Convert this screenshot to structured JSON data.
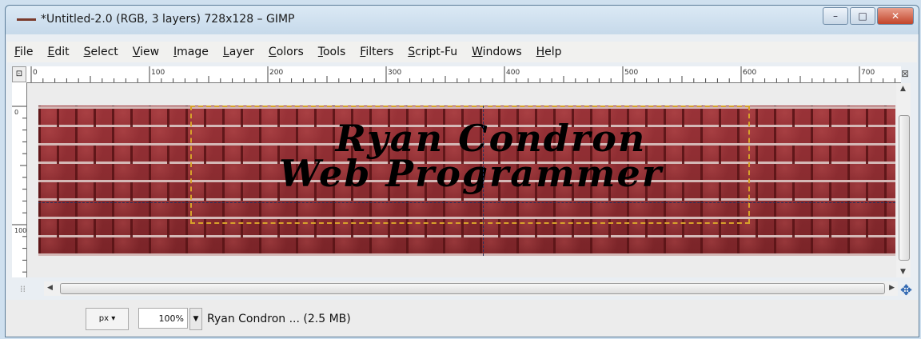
{
  "window": {
    "title": "*Untitled-2.0 (RGB, 3 layers) 728x128 – GIMP",
    "buttons": {
      "minimize": "–",
      "maximize": "□",
      "close": "✕"
    }
  },
  "menu": [
    {
      "label": "File"
    },
    {
      "label": "Edit"
    },
    {
      "label": "Select"
    },
    {
      "label": "View"
    },
    {
      "label": "Image"
    },
    {
      "label": "Layer"
    },
    {
      "label": "Colors"
    },
    {
      "label": "Tools"
    },
    {
      "label": "Filters"
    },
    {
      "label": "Script-Fu"
    },
    {
      "label": "Windows"
    },
    {
      "label": "Help"
    }
  ],
  "ruler": {
    "h_ticks": [
      "0",
      "100",
      "200",
      "300",
      "400",
      "500",
      "600",
      "700"
    ],
    "v_ticks": [
      "0",
      "100"
    ]
  },
  "canvas": {
    "line1": "Ryan Condron",
    "line2": "Web Programmer"
  },
  "status": {
    "unit": "px",
    "zoom": "100%",
    "text": "Ryan Condron ... (2.5 MB)"
  },
  "icons": {
    "navigate": "navigate-icon",
    "zoom_toggle": "zoom-toggle-icon",
    "move": "move-icon",
    "quickmask": "quickmask-icon"
  }
}
